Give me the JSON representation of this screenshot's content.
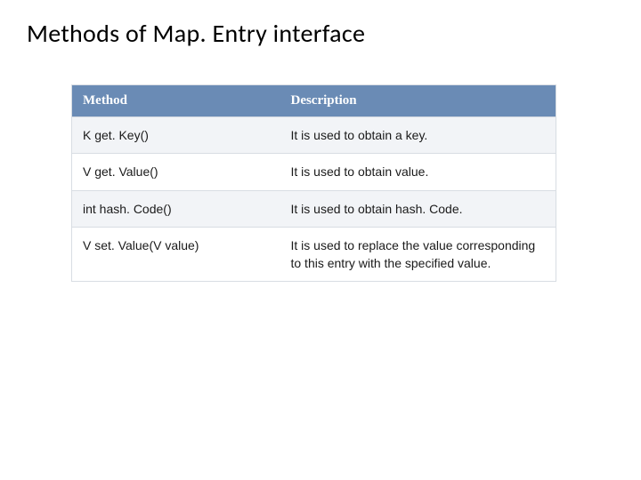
{
  "title": "Methods of Map. Entry interface",
  "table": {
    "headers": {
      "method": "Method",
      "description": "Description"
    },
    "rows": [
      {
        "method": "K get. Key()",
        "description": "It is used to obtain a key."
      },
      {
        "method": "V get. Value()",
        "description": "It is used to obtain value."
      },
      {
        "method": "int hash. Code()",
        "description": "It is used to obtain hash. Code."
      },
      {
        "method": "V set. Value(V value)",
        "description": "It is used to replace the value corresponding to this entry with the specified value."
      }
    ]
  }
}
